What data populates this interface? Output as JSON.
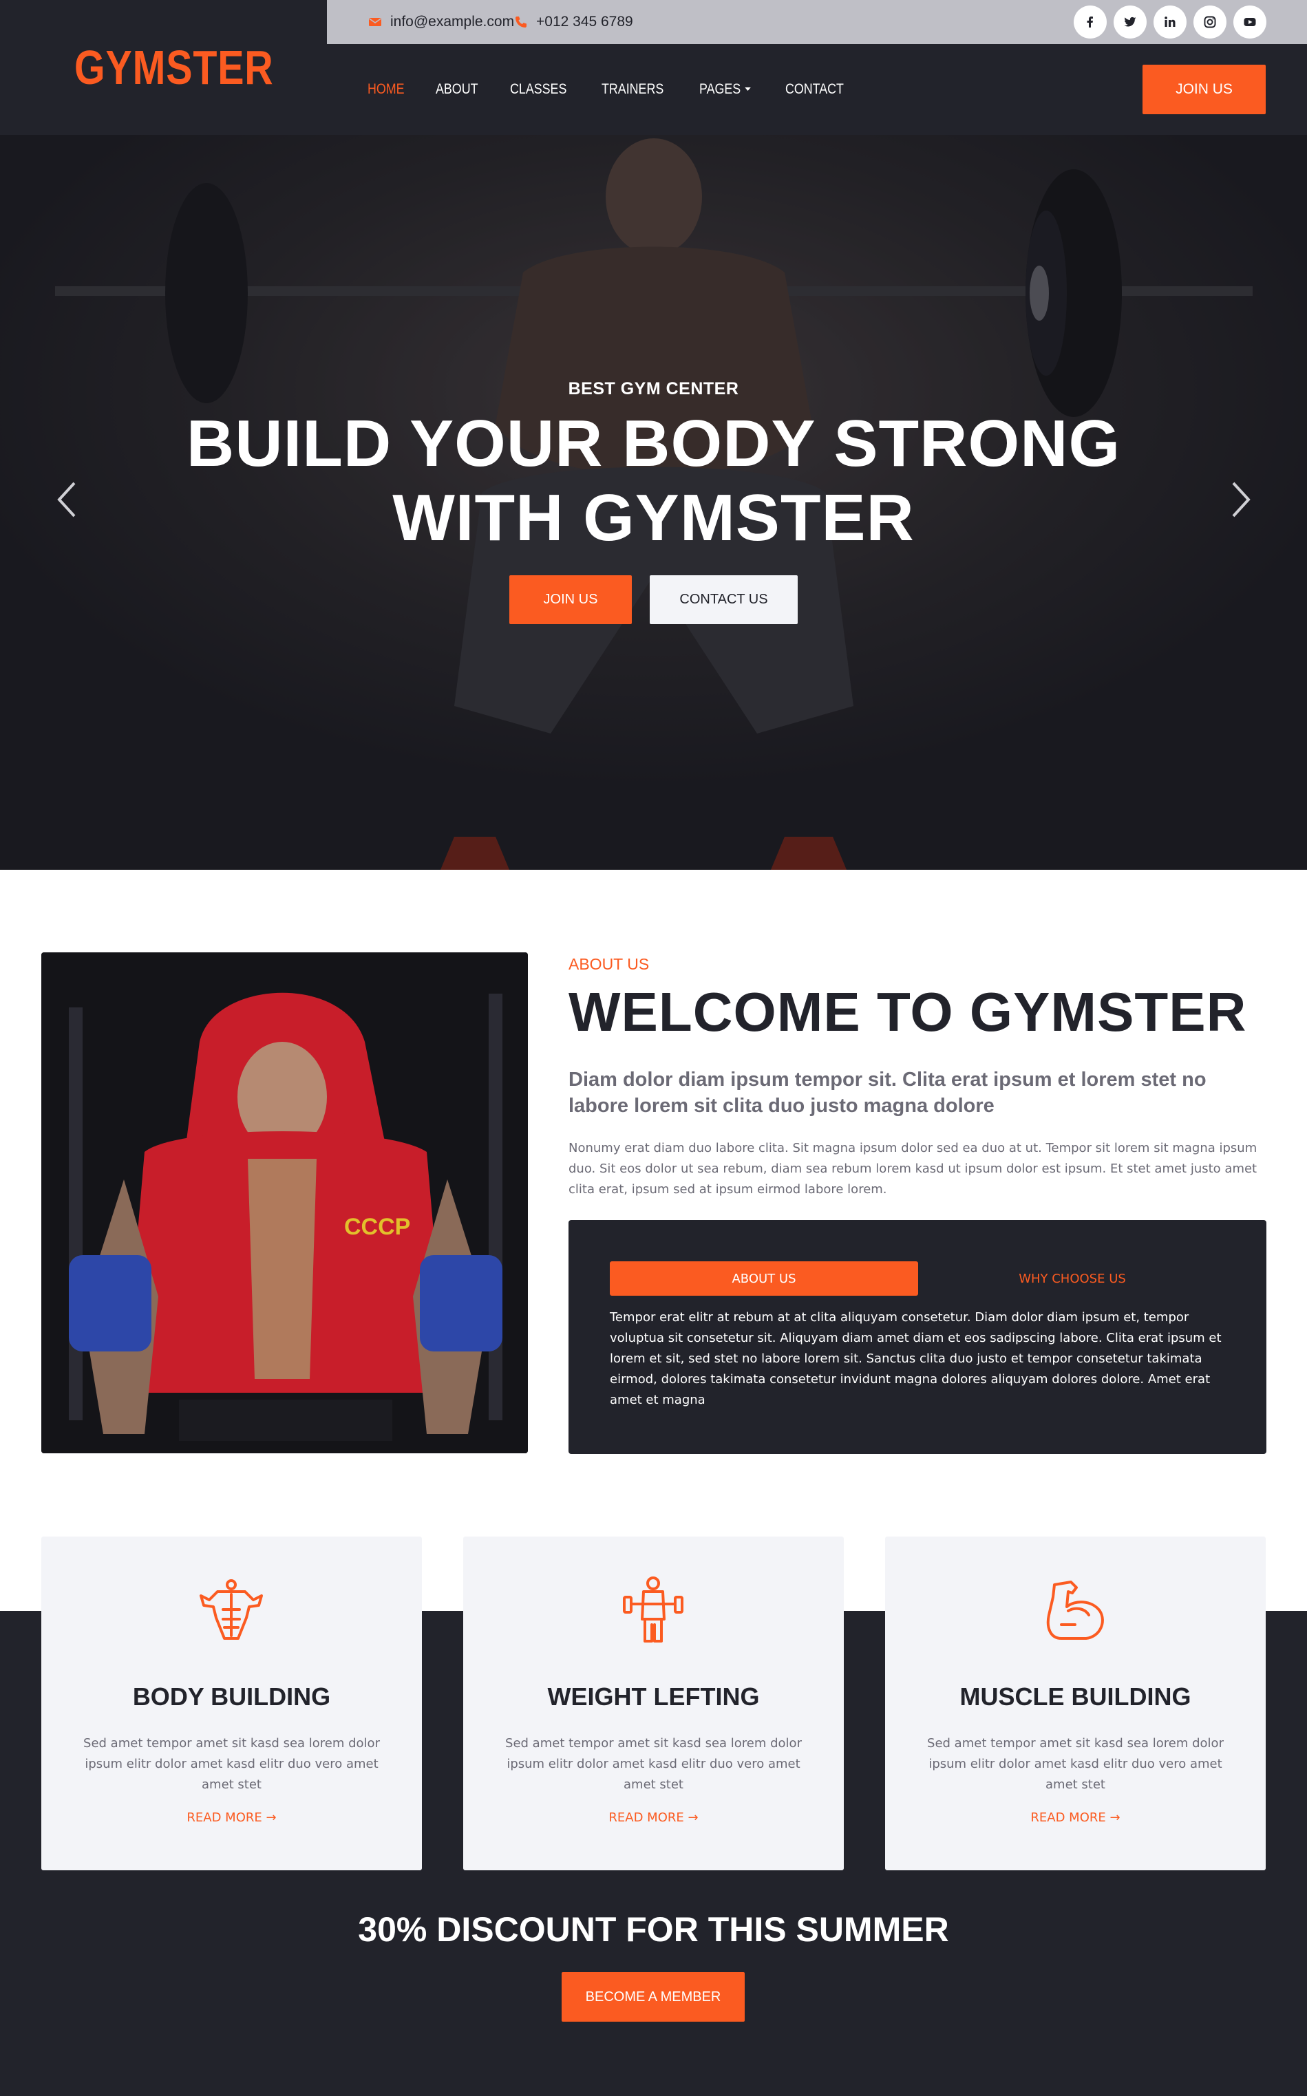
{
  "brand": {
    "logo": "GYMSTER",
    "accent": "#fb5b21",
    "dark": "#22232b",
    "light": "#f3f4f8"
  },
  "topbar": {
    "email": "info@example.com",
    "phone": "+012 345 6789",
    "social_icons": [
      "facebook-icon",
      "twitter-icon",
      "linkedin-icon",
      "instagram-icon",
      "youtube-icon"
    ]
  },
  "nav": {
    "items": [
      "HOME",
      "ABOUT",
      "CLASSES",
      "TRAINERS",
      "PAGES",
      "CONTACT"
    ],
    "active": "HOME",
    "join": "JOIN US"
  },
  "hero": {
    "subtitle": "BEST GYM CENTER",
    "title_line1": "BUILD YOUR BODY STRONG",
    "title_line2": "WITH GYMSTER",
    "btn_join": "JOIN US",
    "btn_contact": "CONTACT US"
  },
  "about": {
    "label": "ABOUT US",
    "title": "WELCOME TO GYMSTER",
    "lead": "Diam dolor diam ipsum tempor sit. Clita erat ipsum et lorem stet no labore lorem sit clita duo justo magna dolore",
    "text": "Nonumy erat diam duo labore clita. Sit magna ipsum dolor sed ea duo at ut. Tempor sit lorem sit magna ipsum duo. Sit eos dolor ut sea rebum, diam sea rebum lorem kasd ut ipsum dolor est ipsum. Et stet amet justo amet clita erat, ipsum sed at ipsum eirmod labore lorem.",
    "tabs": [
      "ABOUT US",
      "WHY CHOOSE US"
    ],
    "tab_text": "Tempor erat elitr at rebum at at clita aliquyam consetetur. Diam dolor diam ipsum et, tempor voluptua sit consetetur sit. Aliquyam diam amet diam et eos sadipscing labore. Clita erat ipsum et lorem et sit, sed stet no labore lorem sit. Sanctus clita duo justo et tempor consetetur takimata eirmod, dolores takimata consetetur invidunt magna dolores aliquyam dolores dolore. Amet erat amet et magna"
  },
  "services": [
    {
      "title": "BODY BUILDING",
      "text": "Sed amet tempor amet sit kasd sea lorem dolor ipsum elitr dolor amet kasd elitr duo vero amet amet stet",
      "more": "READ MORE →",
      "icon": "body-building-icon"
    },
    {
      "title": "WEIGHT LEFTING",
      "text": "Sed amet tempor amet sit kasd sea lorem dolor ipsum elitr dolor amet kasd elitr duo vero amet amet stet",
      "more": "READ MORE →",
      "icon": "weight-lifting-icon"
    },
    {
      "title": "MUSCLE BUILDING",
      "text": "Sed amet tempor amet sit kasd sea lorem dolor ipsum elitr dolor amet kasd elitr duo vero amet amet stet",
      "more": "READ MORE →",
      "icon": "muscle-arm-icon"
    }
  ],
  "promo": {
    "title": "30% DISCOUNT FOR THIS SUMMER",
    "button": "BECOME A MEMBER"
  }
}
